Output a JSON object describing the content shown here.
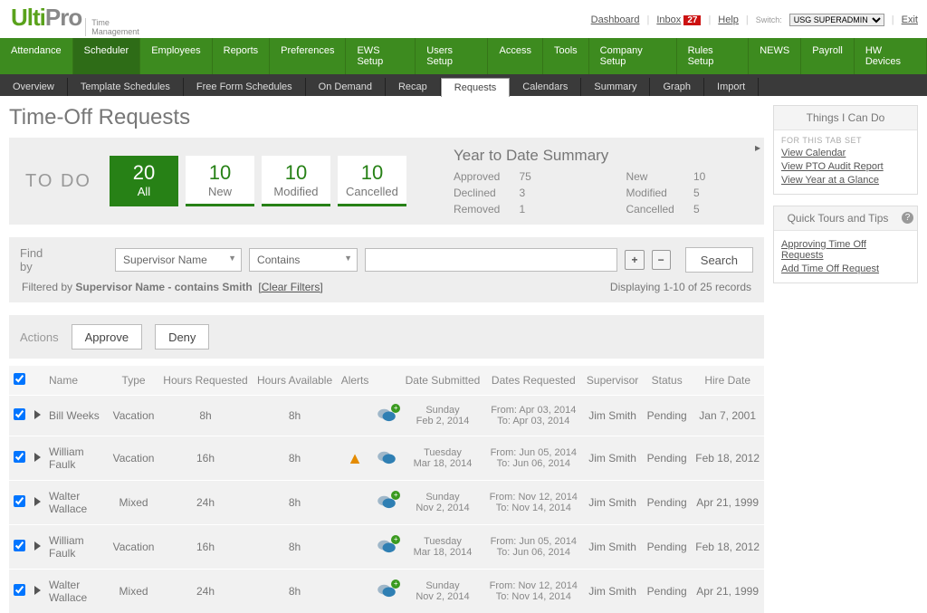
{
  "brand": {
    "part1": "Ulti",
    "part2": "Pro",
    "tag1": "Time",
    "tag2": "Management"
  },
  "toplinks": {
    "dashboard": "Dashboard",
    "inbox": "Inbox",
    "inbox_count": "27",
    "help": "Help",
    "switch_label": "Switch:",
    "switch_value": "USG SUPERADMIN",
    "exit": "Exit"
  },
  "nav": [
    "Attendance",
    "Scheduler",
    "Employees",
    "Reports",
    "Preferences",
    "EWS Setup",
    "Users Setup",
    "Access",
    "Tools",
    "Company Setup",
    "Rules Setup",
    "NEWS",
    "Payroll",
    "HW Devices"
  ],
  "nav_active_index": 1,
  "subnav": [
    "Overview",
    "Template Schedules",
    "Free Form Schedules",
    "On Demand",
    "Recap",
    "Requests",
    "Calendars",
    "Summary",
    "Graph",
    "Import"
  ],
  "subnav_active_index": 5,
  "page_title": "Time-Off Requests",
  "todo_label": "TO DO",
  "tiles": [
    {
      "num": "20",
      "lbl": "All",
      "green": true
    },
    {
      "num": "10",
      "lbl": "New",
      "green": false
    },
    {
      "num": "10",
      "lbl": "Modified",
      "green": false
    },
    {
      "num": "10",
      "lbl": "Cancelled",
      "green": false
    }
  ],
  "ytd": {
    "title": "Year to Date Summary",
    "rows": [
      {
        "l1": "Approved",
        "v1": "75",
        "l2": "New",
        "v2": "10"
      },
      {
        "l1": "Declined",
        "v1": "3",
        "l2": "Modified",
        "v2": "5"
      },
      {
        "l1": "Removed",
        "v1": "1",
        "l2": "Cancelled",
        "v2": "5"
      }
    ]
  },
  "filter": {
    "findby": "Find by",
    "field": "Supervisor Name",
    "op": "Contains",
    "value": "",
    "search": "Search",
    "summary_prefix": "Filtered by ",
    "summary_bold": "Supervisor Name - contains Smith",
    "clear": "[Clear Filters]",
    "paging": "Displaying 1-10 of 25 records"
  },
  "actions": {
    "label": "Actions",
    "approve": "Approve",
    "deny": "Deny"
  },
  "columns": [
    "",
    "",
    "Name",
    "Type",
    "Hours Requested",
    "Hours Available",
    "Alerts",
    "",
    "Date Submitted",
    "Dates Requested",
    "Supervisor",
    "Status",
    "Hire Date"
  ],
  "rows": [
    {
      "name": "Bill Weeks",
      "type": "Vacation",
      "hreq": "8h",
      "havail": "8h",
      "warn": false,
      "sub_day": "Sunday",
      "sub_date": "Feb 2, 2014",
      "from": "Apr 03, 2014",
      "to": "Apr 03, 2014",
      "sup": "Jim Smith",
      "status": "Pending",
      "hire": "Jan 7, 2001"
    },
    {
      "name": "William Faulk",
      "type": "Vacation",
      "hreq": "16h",
      "havail": "8h",
      "warn": true,
      "sub_day": "Tuesday",
      "sub_date": "Mar 18, 2014",
      "from": "Jun 05, 2014",
      "to": "Jun 06, 2014",
      "sup": "Jim Smith",
      "status": "Pending",
      "hire": "Feb 18, 2012"
    },
    {
      "name": "Walter Wallace",
      "type": "Mixed",
      "hreq": "24h",
      "havail": "8h",
      "warn": false,
      "sub_day": "Sunday",
      "sub_date": "Nov 2, 2014",
      "from": "Nov 12, 2014",
      "to": "Nov 14, 2014",
      "sup": "Jim Smith",
      "status": "Pending",
      "hire": "Apr 21, 1999"
    },
    {
      "name": "William Faulk",
      "type": "Vacation",
      "hreq": "16h",
      "havail": "8h",
      "warn": false,
      "sub_day": "Tuesday",
      "sub_date": "Mar 18, 2014",
      "from": "Jun 05, 2014",
      "to": "Jun 06, 2014",
      "sup": "Jim Smith",
      "status": "Pending",
      "hire": "Feb 18, 2012"
    },
    {
      "name": "Walter Wallace",
      "type": "Mixed",
      "hreq": "24h",
      "havail": "8h",
      "warn": false,
      "sub_day": "Sunday",
      "sub_date": "Nov 2, 2014",
      "from": "Nov 12, 2014",
      "to": "Nov 14, 2014",
      "sup": "Jim Smith",
      "status": "Pending",
      "hire": "Apr 21, 1999"
    }
  ],
  "side": {
    "things_title": "Things I Can Do",
    "things_sub": "FOR THIS TAB SET",
    "things_links": [
      "View Calendar",
      "View PTO Audit Report",
      "View Year at a Glance"
    ],
    "tours_title": "Quick Tours and Tips",
    "tours_links": [
      "Approving Time Off Requests",
      "Add Time Off Request"
    ]
  }
}
